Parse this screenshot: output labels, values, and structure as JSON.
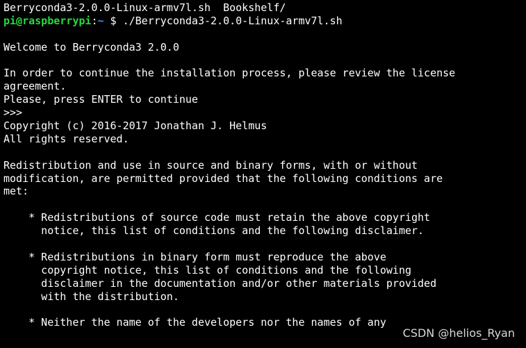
{
  "colors": {
    "background": "#000000",
    "text": "#ffffff",
    "prompt_user": "#27d93f",
    "prompt_path": "#3b8eea",
    "watermark": "#d8d8d8"
  },
  "terminal": {
    "ls_output": "Berryconda3-2.0.0-Linux-armv7l.sh  Bookshelf/",
    "prompt": {
      "user_host": "pi@raspberrypi",
      "colon": ":",
      "path": "~",
      "symbol": " $ ",
      "command": "./Berryconda3-2.0.0-Linux-armv7l.sh"
    },
    "lines": [
      "",
      "Welcome to Berryconda3 2.0.0",
      "",
      "In order to continue the installation process, please review the license",
      "agreement.",
      "Please, press ENTER to continue",
      ">>>",
      "Copyright (c) 2016-2017 Jonathan J. Helmus",
      "All rights reserved.",
      "",
      "Redistribution and use in source and binary forms, with or without",
      "modification, are permitted provided that the following conditions are",
      "met:",
      "",
      "    * Redistributions of source code must retain the above copyright",
      "      notice, this list of conditions and the following disclaimer.",
      "",
      "    * Redistributions in binary form must reproduce the above",
      "      copyright notice, this list of conditions and the following",
      "      disclaimer in the documentation and/or other materials provided",
      "      with the distribution.",
      "",
      "    * Neither the name of the developers nor the names of any"
    ]
  },
  "watermark": "CSDN @helios_Ryan"
}
